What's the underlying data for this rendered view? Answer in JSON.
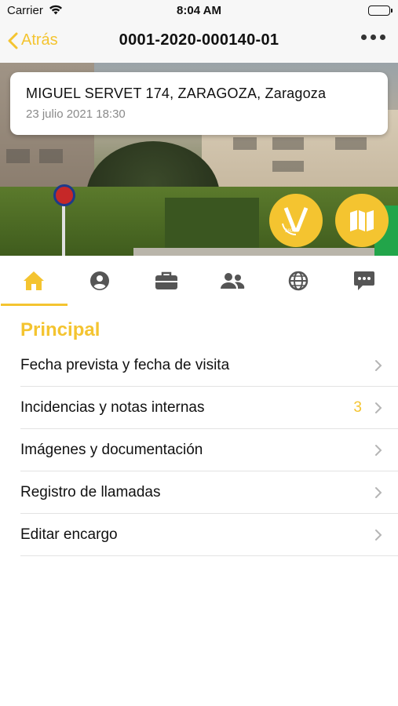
{
  "status_bar": {
    "carrier": "Carrier",
    "time": "8:04 AM"
  },
  "nav": {
    "back_label": "Atrás",
    "title": "0001-2020-000140-01",
    "more_icon": "ellipsis-icon"
  },
  "address_card": {
    "address": "MIGUEL SERVET 174, ZARAGOZA, Zaragoza",
    "date": "23 julio 2021 18:30"
  },
  "actions": {
    "view_360_icon": "view-360-icon",
    "map_icon": "map-icon"
  },
  "tabs": [
    {
      "icon": "home-icon",
      "active": true
    },
    {
      "icon": "person-icon",
      "active": false
    },
    {
      "icon": "briefcase-icon",
      "active": false
    },
    {
      "icon": "people-icon",
      "active": false
    },
    {
      "icon": "globe-icon",
      "active": false
    },
    {
      "icon": "chat-icon",
      "active": false
    }
  ],
  "section": {
    "title": "Principal"
  },
  "menu": [
    {
      "label": "Fecha prevista y fecha de visita",
      "badge": ""
    },
    {
      "label": "Incidencias y notas internas",
      "badge": "3"
    },
    {
      "label": "Imágenes y documentación",
      "badge": ""
    },
    {
      "label": "Registro de llamadas",
      "badge": ""
    },
    {
      "label": "Editar encargo",
      "badge": ""
    }
  ],
  "colors": {
    "accent": "#f4c430",
    "icon_gray": "#555555",
    "divider": "#e3e3e3"
  }
}
